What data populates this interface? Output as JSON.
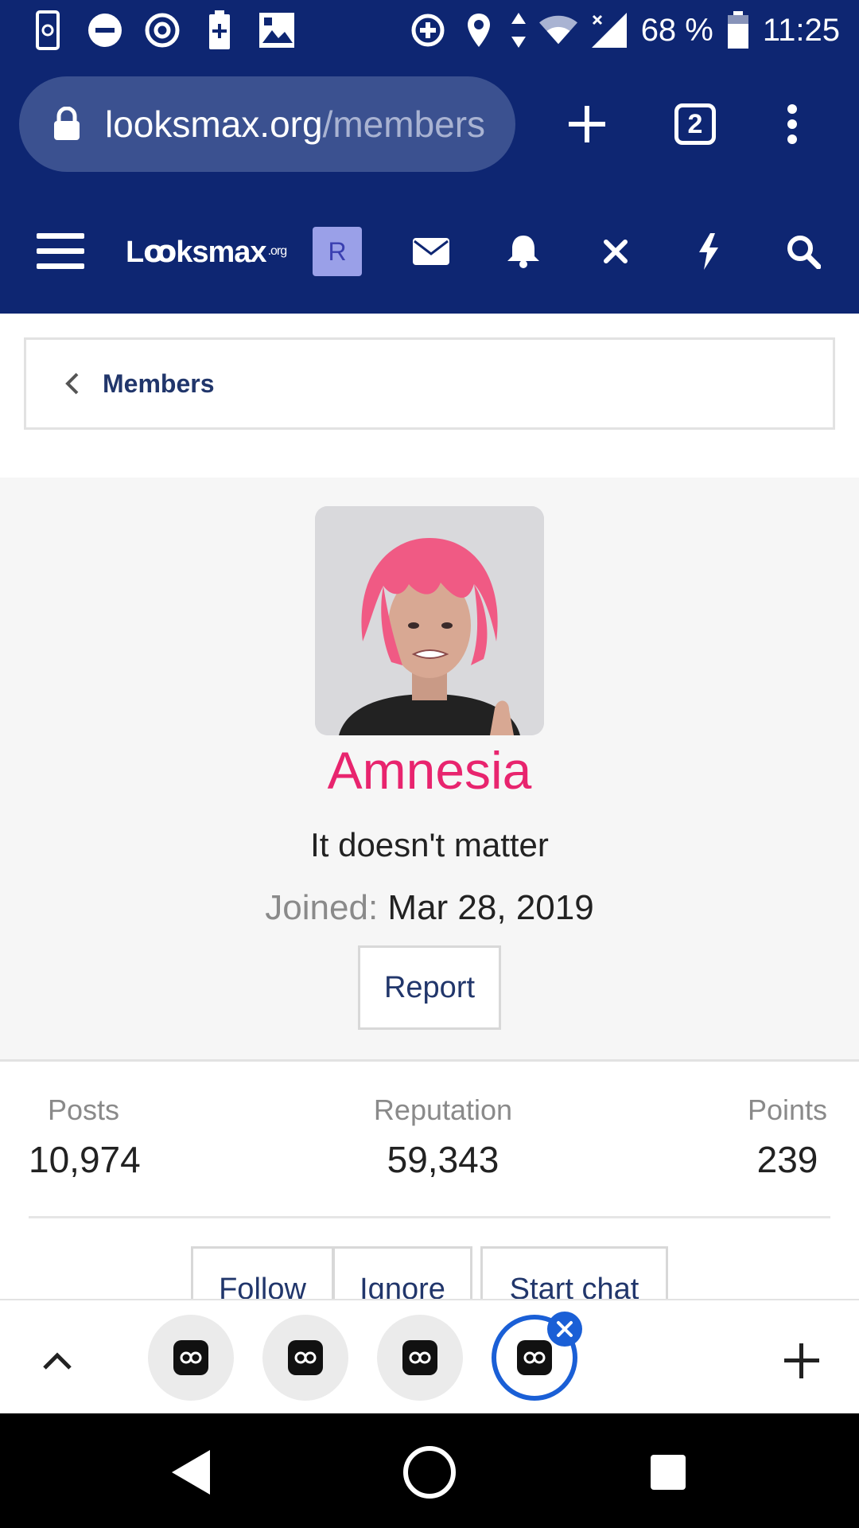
{
  "status_bar": {
    "battery_percent": "68 %",
    "time": "11:25",
    "icons_left": [
      "screen-rotate-icon",
      "do-not-disturb-icon",
      "data-saver-icon",
      "battery-saver-icon",
      "image-icon"
    ],
    "icons_right": [
      "data-saver-plus-icon",
      "location-icon",
      "data-arrows-icon",
      "wifi-icon",
      "cell-signal-icon",
      "battery-icon"
    ]
  },
  "browser": {
    "url_host": "looksmax.org",
    "url_path": "/members",
    "tab_count": "2"
  },
  "site_header": {
    "logo_text": "Lꝏksmax",
    "logo_suffix": ".org",
    "user_initial": "R"
  },
  "breadcrumb": {
    "label": "Members"
  },
  "profile": {
    "username": "Amnesia",
    "custom_title": "It doesn't matter",
    "joined_label": "Joined:",
    "joined_date": "Mar 28, 2019",
    "report_label": "Report"
  },
  "stats": {
    "posts_label": "Posts",
    "posts_value": "10,974",
    "reputation_label": "Reputation",
    "reputation_value": "59,343",
    "points_label": "Points",
    "points_value": "239"
  },
  "actions": {
    "follow_label": "Follow",
    "ignore_label": "Ignore",
    "start_chat_label": "Start chat"
  },
  "colors": {
    "header_bg": "#0e2672",
    "username": "#e8246e",
    "link": "#21366b",
    "active_tab": "#1a5fd6"
  }
}
